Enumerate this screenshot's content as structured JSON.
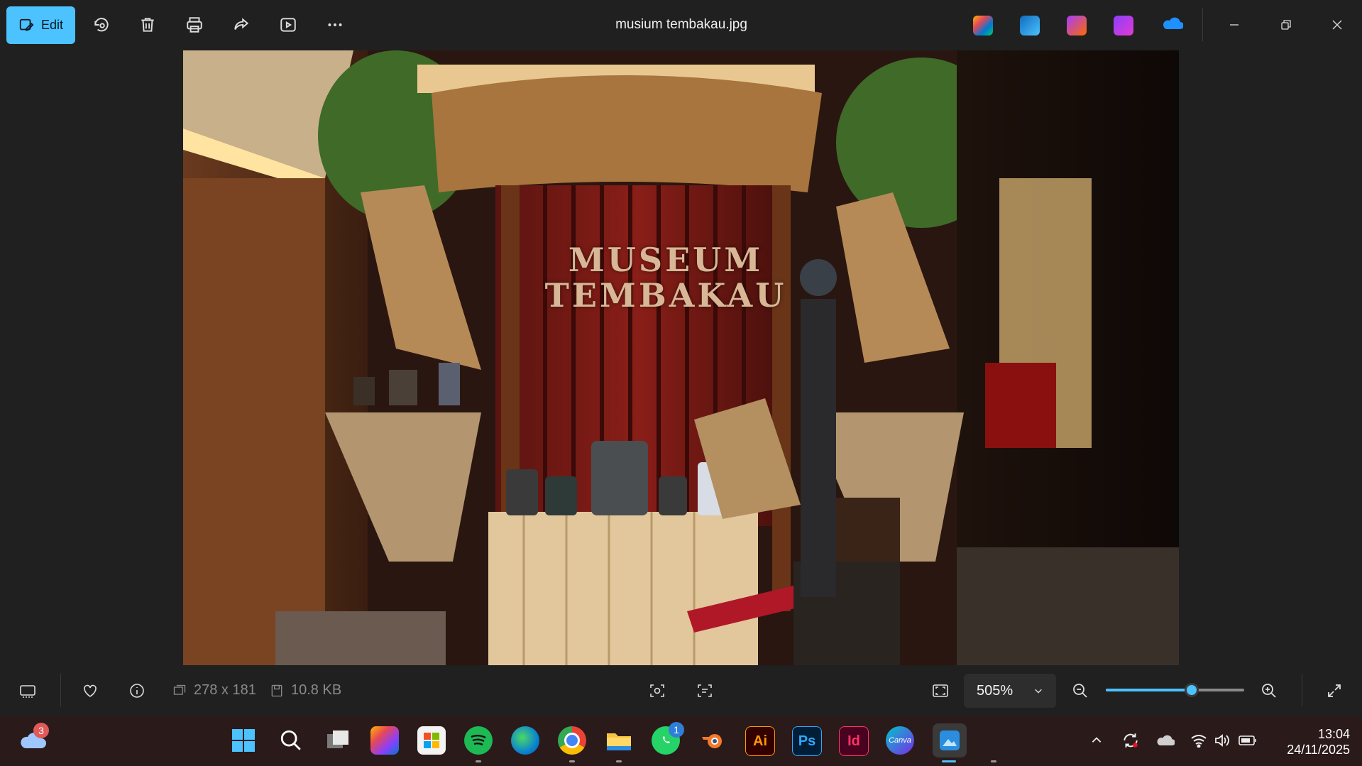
{
  "toolbar": {
    "edit_label": "Edit",
    "title": "musium tembakau.jpg"
  },
  "image": {
    "sign_line1": "MUSEUM",
    "sign_line2": "TEMBAKAU"
  },
  "info": {
    "dimensions": "278 x 181",
    "file_size": "10.8 KB",
    "zoom": "505%",
    "zoom_level_fraction": 0.62
  },
  "taskbar": {
    "weather_badge": "3",
    "whatsapp_badge": "1",
    "icons": [
      "windows-start-icon",
      "search-icon",
      "task-view-icon",
      "copilot-icon",
      "microsoft-store-icon",
      "spotify-icon",
      "edge-icon",
      "chrome-icon",
      "file-explorer-icon",
      "whatsapp-icon",
      "blender-icon",
      "illustrator-icon",
      "photoshop-icon",
      "indesign-icon",
      "canva-icon",
      "photos-icon"
    ],
    "ai_label": "Ai",
    "ps_label": "Ps",
    "id_label": "Id",
    "canva_label": "Canva"
  },
  "clock": {
    "time": "13:04",
    "date": "24/11/2025"
  },
  "colors": {
    "accent": "#4cc2ff",
    "background": "#202020",
    "taskbar": "#2b1a1a"
  }
}
